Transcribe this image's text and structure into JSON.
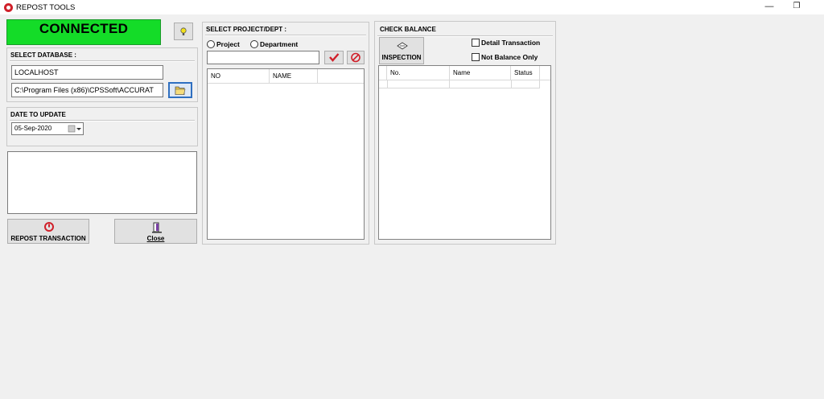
{
  "window": {
    "title": "REPOST TOOLS",
    "minimize": "—",
    "restore": "❐",
    "close": "✕"
  },
  "status": {
    "text": "CONNECTED",
    "color": "#14dc28"
  },
  "database": {
    "title": "SELECT DATABASE :",
    "server": "LOCALHOST",
    "path": "C:\\Program Files (x86)\\CPSSoft\\ACCURAT"
  },
  "date": {
    "title": "DATE  TO UPDATE",
    "value": "05-Sep-2020"
  },
  "actions": {
    "repost_label": "REPOST TRANSACTION",
    "close_label": "Close"
  },
  "project": {
    "title": "SELECT PROJECT/DEPT :",
    "option_project": "Project",
    "option_department": "Department",
    "search_value": "",
    "columns": [
      "NO",
      "NAME"
    ]
  },
  "balance": {
    "title": "CHECK BALANCE",
    "inspection_label": "INSPECTION",
    "detail_label": "Detail Transaction",
    "not_balance_label": "Not Balance Only",
    "columns": [
      "No.",
      "Name",
      "Status"
    ]
  },
  "icons": [
    "app-logo-icon",
    "lightbulb-icon",
    "folder-browse-icon",
    "checkmark-icon",
    "cancel-icon",
    "repost-icon",
    "exit-door-icon",
    "inspection-icon",
    "calendar-icon"
  ]
}
